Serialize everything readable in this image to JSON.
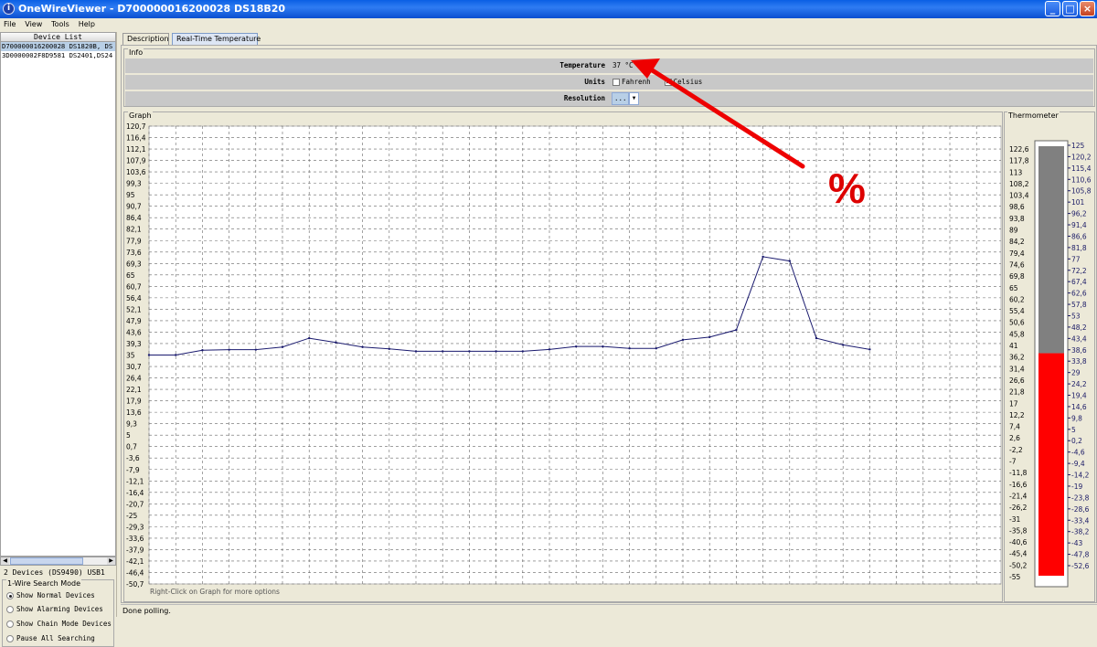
{
  "window": {
    "title": "OneWireViewer - D700000016200028 DS18B20",
    "minimize": "_",
    "maximize": "□",
    "close": "×",
    "app_icon": "info-icon"
  },
  "menu": [
    "File",
    "View",
    "Tools",
    "Help"
  ],
  "device_list": {
    "header": "Device List",
    "items": [
      {
        "label": "D700000016200028 DS1820B, DS",
        "selected": true
      },
      {
        "label": "3D0000002F8D9581 DS2401,DS24",
        "selected": false
      }
    ],
    "count_text": "2 Devices  (DS9490) USB1"
  },
  "search_mode": {
    "title": "1-Wire Search Mode",
    "options": [
      {
        "label": "Show Normal Devices",
        "selected": true
      },
      {
        "label": "Show Alarming Devices",
        "selected": false
      },
      {
        "label": "Show Chain Mode Devices",
        "selected": false
      },
      {
        "label": "Pause All Searching",
        "selected": false
      }
    ]
  },
  "tabs": [
    {
      "label": "Description",
      "active": false
    },
    {
      "label": "Real-Time Temperature",
      "active": true
    }
  ],
  "info": {
    "title": "Info",
    "temperature_label": "Temperature",
    "temperature_value": "37 °C",
    "units_label": "Units",
    "units_fahrenheit": "Fahrenh",
    "units_celsius": "Celsius",
    "celsius_checked": true,
    "resolution_label": "Resolution",
    "resolution_value": "..."
  },
  "graph": {
    "title": "Graph",
    "hint": "Right-Click on Graph for more options"
  },
  "thermometer": {
    "title": "Thermometer",
    "value": 37,
    "fill_color": "#ff0000",
    "empty_color": "#808080"
  },
  "status": "Done polling.",
  "annotation": {
    "symbol": "%",
    "color": "#dd0000"
  },
  "chart_data": {
    "type": "line",
    "title": "",
    "xlabel": "",
    "ylabel": "",
    "y_ticks": [
      "120,7",
      "116,4",
      "112,1",
      "107,9",
      "103,6",
      "99,3",
      "95",
      "90,7",
      "86,4",
      "82,1",
      "77,9",
      "73,6",
      "69,3",
      "65",
      "60,7",
      "56,4",
      "52,1",
      "47,9",
      "43,6",
      "39,3",
      "35",
      "30,7",
      "26,4",
      "22,1",
      "17,9",
      "13,6",
      "9,3",
      "5",
      "0,7",
      "-3,6",
      "-7,9",
      "-12,1",
      "-16,4",
      "-20,7",
      "-25",
      "-29,3",
      "-33,6",
      "-37,9",
      "-42,1",
      "-46,4",
      "-50,7"
    ],
    "ylim": [
      -50.7,
      120.7
    ],
    "grid": true,
    "series": [
      {
        "values": [
          35,
          35,
          36.8,
          37,
          37,
          38,
          41.3,
          39.7,
          38,
          37.3,
          36.4,
          36.4,
          36.4,
          36.4,
          36.4,
          37.1,
          38.2,
          38.2,
          37.5,
          37.5,
          40.7,
          41.7,
          44.4,
          71.8,
          70.2,
          41.3,
          38.8,
          37.1
        ]
      }
    ],
    "left_scale": [
      "122,6",
      "117,8",
      "113",
      "108,2",
      "103,4",
      "98,6",
      "93,8",
      "89",
      "84,2",
      "79,4",
      "74,6",
      "69,8",
      "65",
      "60,2",
      "55,4",
      "50,6",
      "45,8",
      "41",
      "36,2",
      "31,4",
      "26,6",
      "21,8",
      "17",
      "12,2",
      "7,4",
      "2,6",
      "-2,2",
      "-7",
      "-11,8",
      "-16,6",
      "-21,4",
      "-26,2",
      "-31",
      "-35,8",
      "-40,6",
      "-45,4",
      "-50,2",
      "-55"
    ],
    "right_scale": [
      "125",
      "120,2",
      "115,4",
      "110,6",
      "105,8",
      "101",
      "96,2",
      "91,4",
      "86,6",
      "81,8",
      "77",
      "72,2",
      "67,4",
      "62,6",
      "57,8",
      "53",
      "48,2",
      "43,4",
      "38,6",
      "33,8",
      "29",
      "24,2",
      "19,4",
      "14,6",
      "9,8",
      "5",
      "0,2",
      "-4,6",
      "-9,4",
      "-14,2",
      "-19",
      "-23,8",
      "-28,6",
      "-33,4",
      "-38,2",
      "-43",
      "-47,8",
      "-52,6"
    ]
  }
}
